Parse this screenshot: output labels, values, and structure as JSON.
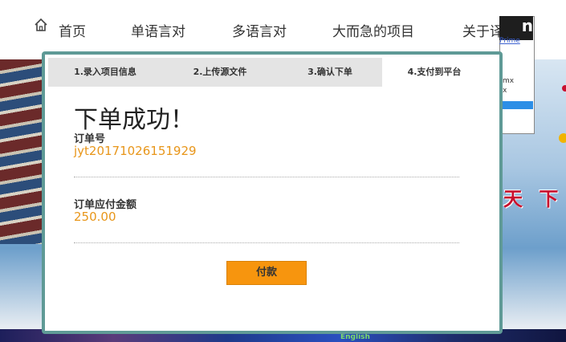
{
  "nav": {
    "items": [
      "首页",
      "单语言对",
      "多语言对",
      "大而急的项目",
      "关于译网"
    ]
  },
  "modal": {
    "steps": [
      "1.录入项目信息",
      "2.上传源文件",
      "3.确认下单",
      "4.支付到平台"
    ],
    "active_step": 4,
    "title": "下单成功！",
    "order_no_label": "订单号",
    "order_no": "jyt20171026151929",
    "amount_label": "订单应付金额",
    "amount": "250.00",
    "pay_button": "付款"
  },
  "background": {
    "promo_logo": "n",
    "promo_link": "Prime",
    "promo_text": "mx",
    "promo_text2": "x",
    "banner_text": "天 下",
    "strip_label": "English"
  },
  "colors": {
    "accent_orange": "#f7950e",
    "value_orange": "#e8961a",
    "modal_border": "#5f9a96",
    "step_bar": "#e4e4e4"
  }
}
